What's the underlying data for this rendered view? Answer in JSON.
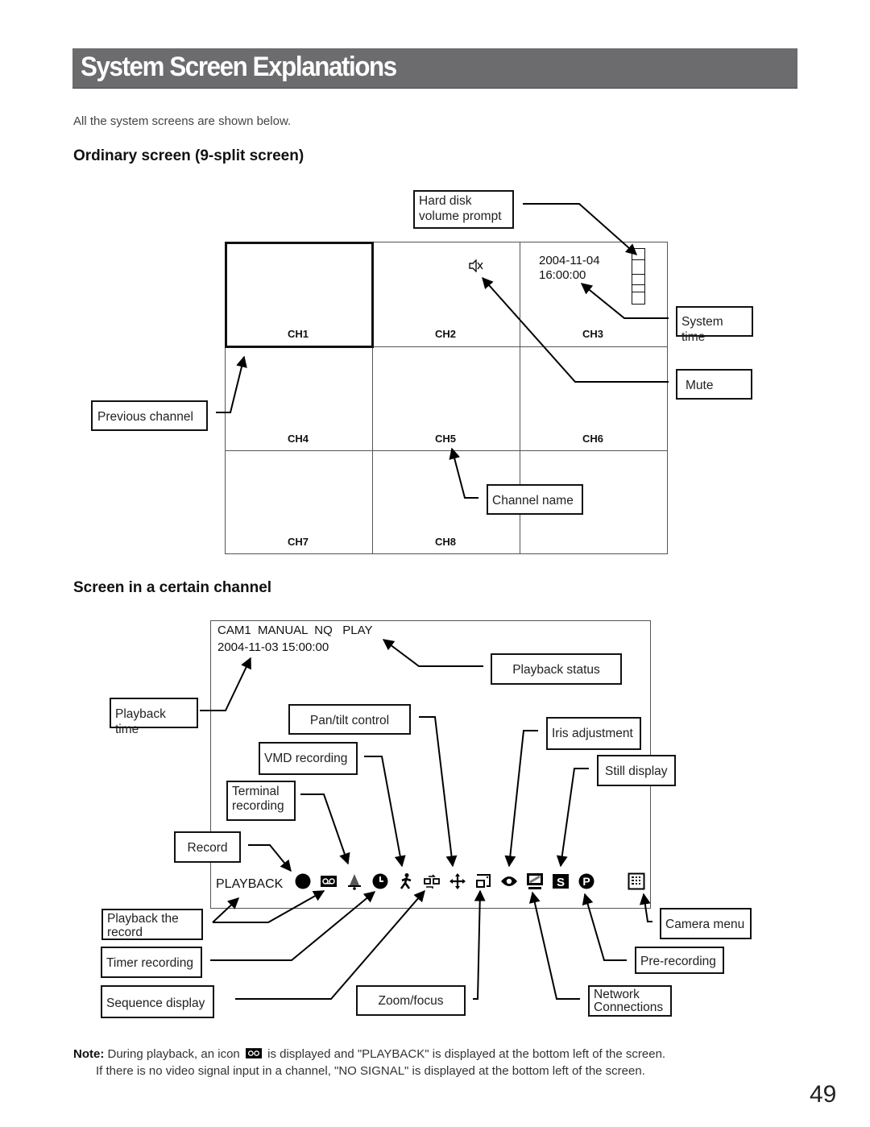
{
  "page": {
    "title": "System Screen Explanations",
    "intro": "All the system screens are shown below.",
    "page_number": "49"
  },
  "section1": {
    "heading": "Ordinary screen (9-split screen)",
    "channels": [
      "CH1",
      "CH2",
      "CH3",
      "CH4",
      "CH5",
      "CH6",
      "CH7",
      "CH8",
      ""
    ],
    "system_date": "2004-11-04",
    "system_time": "16:00:00",
    "callouts": {
      "hard_disk_line1": "Hard disk",
      "hard_disk_line2": "volume prompt",
      "system_time": "System time",
      "mute": "Mute",
      "previous_channel": "Previous channel",
      "channel_name": "Channel name"
    }
  },
  "section2": {
    "heading": "Screen in a certain channel",
    "status_line": "CAM1  MANUAL  NQ   PLAY",
    "datetime_line": "2004-11-03 15:00:00",
    "playback_label": "PLAYBACK",
    "icons": [
      "record-icon",
      "playback-tape-icon",
      "terminal-alarm-icon",
      "timer-clock-icon",
      "vmd-person-icon",
      "sequence-icon",
      "pan-tilt-icon",
      "zoom-focus-icon",
      "iris-icon",
      "network-monitor-icon",
      "still-s-icon",
      "pre-recording-p-icon",
      "camera-menu-icon"
    ],
    "callouts": {
      "playback_status": "Playback status",
      "playback_time": "Playback time",
      "pan_tilt": "Pan/tilt control",
      "iris": "Iris adjustment",
      "vmd": "VMD recording",
      "still": "Still display",
      "terminal_line1": "Terminal",
      "terminal_line2": "recording",
      "record": "Record",
      "playback_record_line1": "Playback the",
      "playback_record_line2": "record",
      "camera_menu": "Camera menu",
      "timer": "Timer recording",
      "pre_recording": "Pre-recording",
      "sequence": "Sequence display",
      "zoom_focus": "Zoom/focus",
      "network_line1": "Network",
      "network_line2": "Connections"
    }
  },
  "note": {
    "label": "Note:",
    "line1_a": "During playback, an icon",
    "line1_b": "is displayed and \"PLAYBACK\" is displayed at the bottom left of the screen.",
    "line2": "If there is no video signal input in a channel, \"NO SIGNAL\" is displayed at the bottom left of the screen."
  }
}
